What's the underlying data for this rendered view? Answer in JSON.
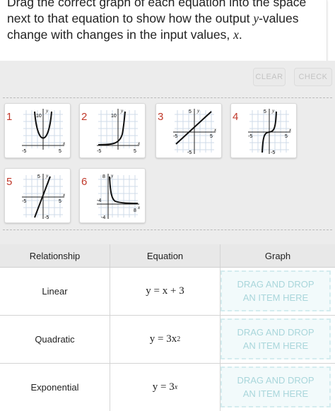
{
  "instructions": {
    "line1": "Drag the correct graph of each equation into the space",
    "line2a": "next to that equation to show how the output ",
    "var_y": "y",
    "line2b": "-values",
    "line3a": "change with changes in the input values, ",
    "var_x": "x",
    "line3b": "."
  },
  "buttons": {
    "clear": "CLEAR",
    "check": "CHECK"
  },
  "tiles": [
    {
      "number": "1",
      "ytick": "10",
      "xneg": "-5",
      "xpos": "5",
      "ylabel": "y",
      "xlabel": "x"
    },
    {
      "number": "2",
      "ytick": "10",
      "xneg": "-5",
      "xpos": "5",
      "ylabel": "y",
      "xlabel": "x"
    },
    {
      "number": "3",
      "ytick": "5",
      "yneg": "-5",
      "xneg": "-5",
      "xpos": "5",
      "ylabel": "y",
      "xlabel": "x"
    },
    {
      "number": "4",
      "ytick": "5",
      "yneg": "-5",
      "xneg": "-5",
      "xpos": "5",
      "ylabel": "y",
      "xlabel": "x"
    },
    {
      "number": "5",
      "ytick": "5",
      "yneg": "-5",
      "xneg": "-5",
      "xpos": "5",
      "ylabel": "y",
      "xlabel": "x"
    },
    {
      "number": "6",
      "ytick": "8",
      "yneg": "-4",
      "xneg": "-4",
      "xpos": "8",
      "ylabel": "y",
      "xlabel": "x"
    }
  ],
  "table": {
    "headers": [
      "Relationship",
      "Equation",
      "Graph"
    ],
    "rows": [
      {
        "relationship": "Linear",
        "eq_main": "y = x + 3",
        "eq_sup": "",
        "drop_line1": "DRAG AND DROP",
        "drop_line2": "AN ITEM HERE"
      },
      {
        "relationship": "Quadratic",
        "eq_main": "y = 3x",
        "eq_sup": "2",
        "drop_line1": "DRAG AND DROP",
        "drop_line2": "AN ITEM HERE"
      },
      {
        "relationship": "Exponential",
        "eq_main": "y = 3",
        "eq_sup": "x",
        "drop_line1": "DRAG AND DROP",
        "drop_line2": "AN ITEM HERE"
      }
    ]
  },
  "colors": {
    "tile_number": "#c0392b",
    "curve": "#111111",
    "grid": "#cfdbe8",
    "drop_text": "#a9d6db"
  }
}
